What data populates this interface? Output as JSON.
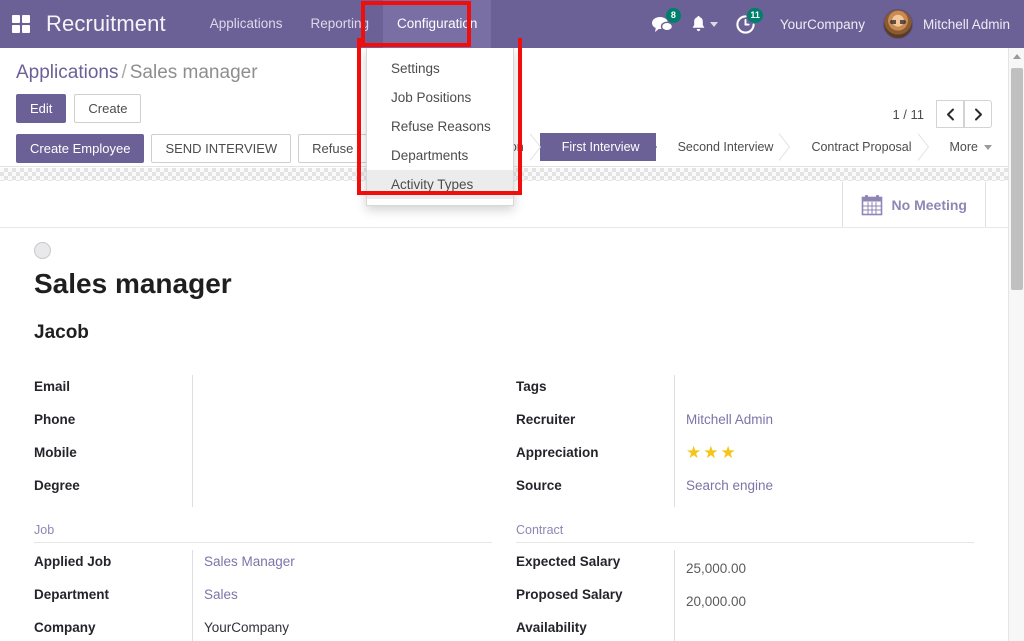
{
  "app": {
    "name": "Recruitment",
    "apps_icon": "apps-grid-icon"
  },
  "navbar": {
    "menus": [
      {
        "label": "Applications",
        "active": false
      },
      {
        "label": "Reporting",
        "active": false
      },
      {
        "label": "Configuration",
        "active": true
      }
    ],
    "messages_icon": "chat-bubble-icon",
    "messages_count": "8",
    "activities_bell_icon": "bell-icon",
    "clock_icon": "clock-activity-icon",
    "activities_count": "11",
    "company": "YourCompany",
    "user": "Mitchell Admin",
    "avatar_icon": "user-avatar"
  },
  "dropdown": {
    "items": [
      {
        "label": "Settings",
        "hovered": false
      },
      {
        "label": "Job Positions",
        "hovered": false
      },
      {
        "label": "Refuse Reasons",
        "hovered": false
      },
      {
        "label": "Departments",
        "hovered": false
      },
      {
        "label": "Activity Types",
        "hovered": true
      }
    ]
  },
  "control_panel": {
    "breadcrumb_root": "Applications",
    "breadcrumb_sep": "/",
    "breadcrumb_current": "Sales manager",
    "edit_label": "Edit",
    "create_label": "Create",
    "pager_text": "1 / 11",
    "prev_icon": "chevron-left-icon",
    "next_icon": "chevron-right-icon",
    "action_buttons": [
      {
        "label": "Create Employee",
        "primary": true
      },
      {
        "label": "SEND INTERVIEW",
        "primary": false
      },
      {
        "label": "Refuse",
        "primary": false
      }
    ],
    "stages": [
      {
        "label": "Qualification",
        "active": false
      },
      {
        "label": "First Interview",
        "active": true
      },
      {
        "label": "Second Interview",
        "active": false
      },
      {
        "label": "Contract Proposal",
        "active": false
      },
      {
        "label": "More",
        "active": false,
        "caret": true
      }
    ]
  },
  "smart_button": {
    "label": "No Meeting",
    "icon": "calendar-icon"
  },
  "record": {
    "state_indicator": "kanban-state-grey",
    "title": "Sales manager",
    "subtitle": "Jacob"
  },
  "form": {
    "left": {
      "rows": [
        {
          "label": "Email",
          "value": "",
          "style": "plain"
        },
        {
          "label": "Phone",
          "value": "",
          "style": "plain"
        },
        {
          "label": "Mobile",
          "value": "",
          "style": "plain"
        },
        {
          "label": "Degree",
          "value": "",
          "style": "plain"
        }
      ],
      "section": "Job",
      "section_rows": [
        {
          "label": "Applied Job",
          "value": "Sales Manager",
          "style": "link"
        },
        {
          "label": "Department",
          "value": "Sales",
          "style": "link"
        },
        {
          "label": "Company",
          "value": "YourCompany",
          "style": "dark"
        }
      ]
    },
    "right": {
      "rows": [
        {
          "label": "Tags",
          "value": "",
          "style": "plain"
        },
        {
          "label": "Recruiter",
          "value": "Mitchell Admin",
          "style": "link"
        },
        {
          "label": "Appreciation",
          "value": "★★★",
          "style": "stars"
        },
        {
          "label": "Source",
          "value": "Search engine",
          "style": "link"
        }
      ],
      "section": "Contract",
      "section_rows": [
        {
          "label": "Expected Salary",
          "value": "25,000.00",
          "style": "money"
        },
        {
          "label": "Proposed Salary",
          "value": "20,000.00",
          "style": "money"
        },
        {
          "label": "Availability",
          "value": "",
          "style": "money"
        }
      ]
    }
  },
  "scrollbar": {
    "up_arrow_icon": "scroll-up-arrow-icon",
    "thumb": "scroll-thumb"
  },
  "annotations": {
    "highlight_color": "#f20d0d",
    "boxes": [
      {
        "name": "configuration-menu-highlight"
      },
      {
        "name": "configuration-dropdown-highlight"
      }
    ]
  },
  "colors": {
    "brand_purple": "#6c6196",
    "menu_active": "#7a6fa5",
    "badge_teal": "#00806c",
    "star_gold": "#f5c518",
    "link_purple": "#7d74a8"
  }
}
